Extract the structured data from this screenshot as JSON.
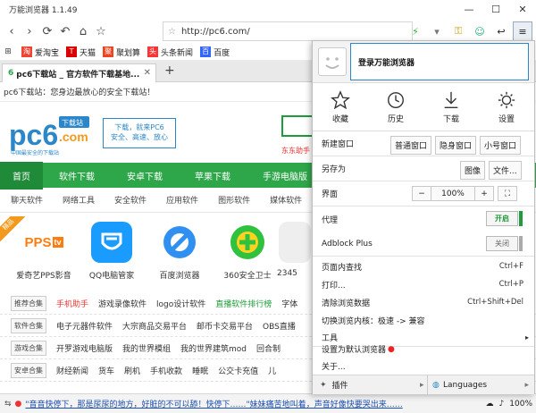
{
  "window": {
    "title": "万能浏览器 1.1.49"
  },
  "toolbar": {
    "url": "http://pc6.com/"
  },
  "bookmarks": [
    {
      "label": "爱淘宝",
      "color": "#e43"
    },
    {
      "label": "天猫",
      "color": "#d00"
    },
    {
      "label": "聚划算",
      "color": "#e42"
    },
    {
      "label": "头条新闻",
      "color": "#f33"
    },
    {
      "label": "百度",
      "color": "#36f"
    }
  ],
  "tab": {
    "title": "pc6下载站 _ 官方软件下载基地..."
  },
  "page": {
    "infobar": "pc6下载站：您身边最放心的安全下载站！",
    "logo_text": "pc6",
    "logo_badge": "下载站",
    "logo_sub": ".com",
    "logo_tag": "中国最安全的下载站",
    "slogan": [
      "下载，就来PC6",
      "安全、高速、放心"
    ],
    "hot_search": "东东助手",
    "main_nav": [
      "首页",
      "软件下载",
      "安卓下载",
      "苹果下载",
      "手游电脑版"
    ],
    "sub_nav": [
      "聊天软件",
      "网络工具",
      "安全软件",
      "应用软件",
      "图形软件",
      "媒体软件"
    ],
    "apps": [
      {
        "label": "爱奇艺PPS影音",
        "icon": "pps-icon",
        "color": "#ff7c10"
      },
      {
        "label": "QQ电脑管家",
        "icon": "qq-manager-icon",
        "color": "#1a9cff"
      },
      {
        "label": "百度浏览器",
        "icon": "baidu-browser-icon",
        "color": "#2f90f2"
      },
      {
        "label": "360安全卫士",
        "icon": "360-icon",
        "color": "#2ec23e"
      },
      {
        "label": "2345",
        "icon": "2345-icon",
        "color": "#f2f2f2"
      }
    ],
    "hot_badge": "精品",
    "rows": [
      {
        "cat": "推荐合集",
        "items": [
          "手机助手",
          "游戏录像软件",
          "logo设计软件",
          "直播软件排行榜",
          "字体"
        ]
      },
      {
        "cat": "软件合集",
        "items": [
          "电子元器件软件",
          "大宗商品交易平台",
          "邮币卡交易平台",
          "OBS直播"
        ]
      },
      {
        "cat": "游戏合集",
        "items": [
          "开罗游戏电脑版",
          "我的世界模组",
          "我的世界建筑mod",
          "回合制"
        ]
      },
      {
        "cat": "安卓合集",
        "items": [
          "财经新闻",
          "货车",
          "刷机",
          "手机收款",
          "睡眠",
          "公交卡充值",
          "儿"
        ]
      }
    ]
  },
  "status": {
    "news": "\"音音快停下，那是尿尿的地方，好脏的不可以舔！快停下……\"妹妹痛苦地叫着，声音好像快要哭出来……",
    "zoom": "100%"
  },
  "menu": {
    "login": "登录万能浏览器",
    "quick": [
      {
        "label": "收藏",
        "icon": "star-icon"
      },
      {
        "label": "历史",
        "icon": "clock-icon"
      },
      {
        "label": "下载",
        "icon": "download-icon"
      },
      {
        "label": "设置",
        "icon": "gear-icon"
      }
    ],
    "new_window": "新建窗口",
    "win_normal": "普通窗口",
    "win_private": "隐身窗口",
    "win_small": "小号窗口",
    "save_as": "另存为",
    "save_image": "图像",
    "save_file": "文件...",
    "interface": "界面",
    "zoom_minus": "−",
    "zoom_value": "100%",
    "zoom_plus": "+",
    "proxy": "代理",
    "proxy_state": "开启",
    "adblock": "Adblock Plus",
    "adblock_state": "关闭",
    "find": "页面内查找",
    "find_shortcut": "Ctrl+F",
    "print": "打印...",
    "print_shortcut": "Ctrl+P",
    "clear": "清除浏览数据",
    "clear_shortcut": "Ctrl+Shift+Del",
    "switch_core": "切换浏览内核：极速 -> 兼容",
    "tools": "工具",
    "set_default": "设置为默认浏览器",
    "about": "关于...",
    "plugins": "插件",
    "languages": "Languages"
  }
}
